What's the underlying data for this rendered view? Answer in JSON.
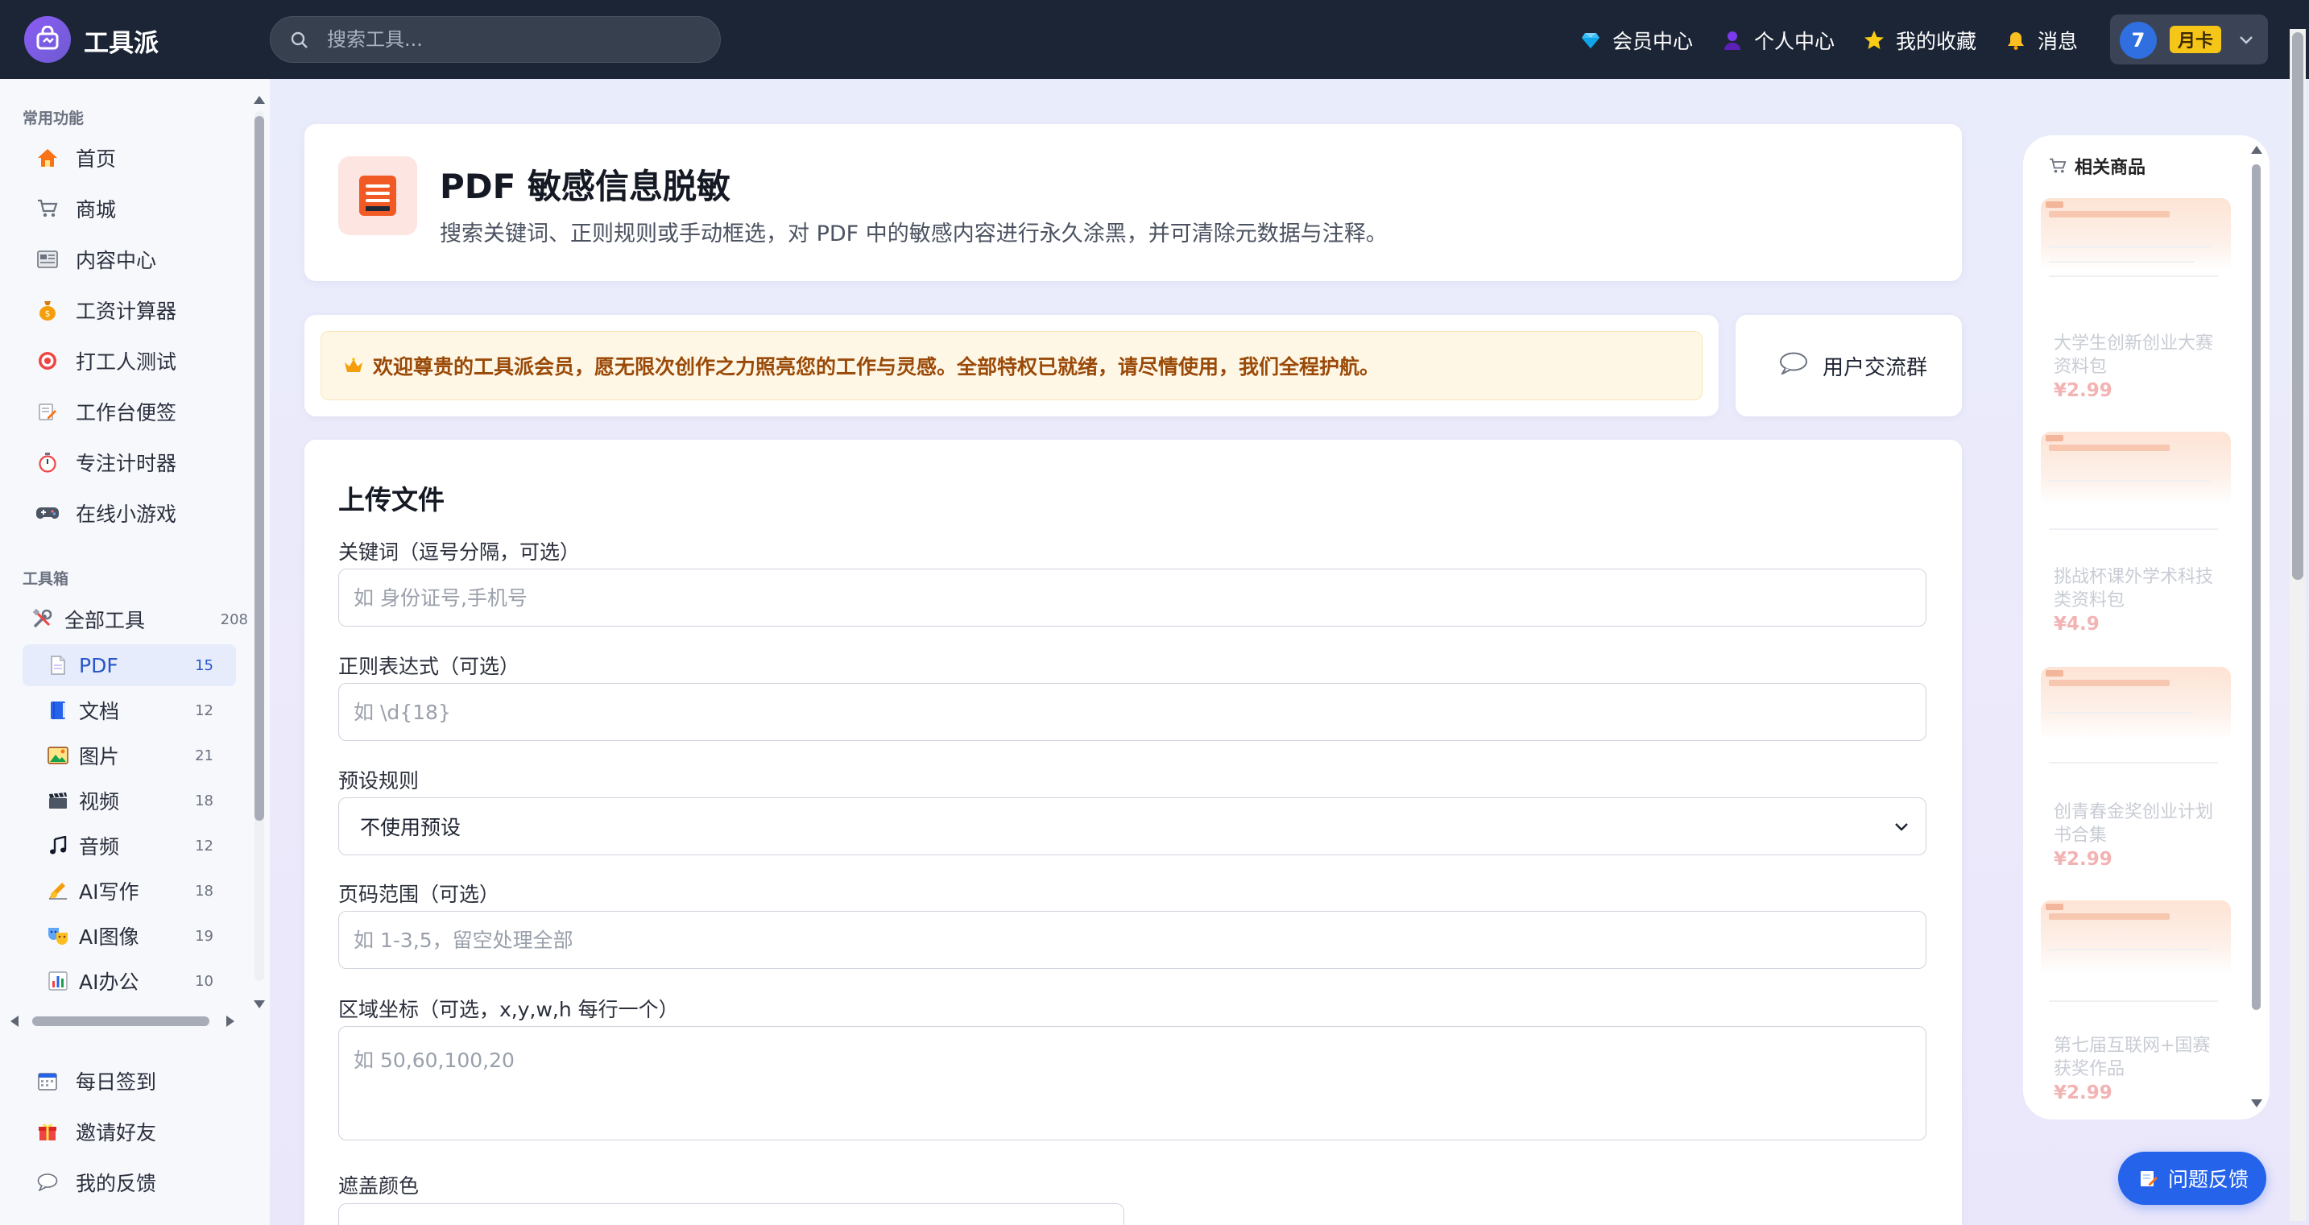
{
  "app": {
    "name": "工具派"
  },
  "search": {
    "placeholder": "搜索工具..."
  },
  "topnav": {
    "items": [
      {
        "label": "会员中心",
        "icon": "diamond-icon"
      },
      {
        "label": "个人中心",
        "icon": "person-icon"
      },
      {
        "label": "我的收藏",
        "icon": "star-icon"
      },
      {
        "label": "消息",
        "icon": "bell-icon"
      }
    ],
    "user": {
      "avatar_text": "7",
      "badge": "月卡"
    }
  },
  "sidebar": {
    "section_common": "常用功能",
    "common_items": [
      {
        "label": "首页",
        "icon": "home-icon"
      },
      {
        "label": "商城",
        "icon": "cart-icon"
      },
      {
        "label": "内容中心",
        "icon": "newspaper-icon"
      },
      {
        "label": "工资计算器",
        "icon": "money-bag-icon"
      },
      {
        "label": "打工人测试",
        "icon": "target-icon"
      },
      {
        "label": "工作台便签",
        "icon": "memo-icon"
      },
      {
        "label": "专注计时器",
        "icon": "stopwatch-icon"
      },
      {
        "label": "在线小游戏",
        "icon": "gamepad-icon"
      }
    ],
    "section_toolbox": "工具箱",
    "all_tools": {
      "label": "全部工具",
      "count": "208",
      "icon": "tools-icon"
    },
    "categories": [
      {
        "label": "PDF",
        "count": "15",
        "icon": "pdf-page-icon",
        "active": true
      },
      {
        "label": "文档",
        "count": "12",
        "icon": "book-icon"
      },
      {
        "label": "图片",
        "count": "21",
        "icon": "picture-icon"
      },
      {
        "label": "视频",
        "count": "18",
        "icon": "clapper-icon"
      },
      {
        "label": "音频",
        "count": "12",
        "icon": "music-note-icon"
      },
      {
        "label": "AI写作",
        "count": "18",
        "icon": "writing-hand-icon"
      },
      {
        "label": "AI图像",
        "count": "19",
        "icon": "theater-mask-icon"
      },
      {
        "label": "AI办公",
        "count": "10",
        "icon": "bar-chart-icon"
      }
    ],
    "bottom_items": [
      {
        "label": "每日签到",
        "icon": "calendar-icon"
      },
      {
        "label": "邀请好友",
        "icon": "gift-icon"
      },
      {
        "label": "我的反馈",
        "icon": "speech-bubble-icon"
      }
    ]
  },
  "tool": {
    "title": "PDF 敏感信息脱敏",
    "description": "搜索关键词、正则规则或手动框选，对 PDF 中的敏感内容进行永久涂黑，并可清除元数据与注释。",
    "icon": "document-icon"
  },
  "welcome": {
    "text": "欢迎尊贵的工具派会员，愿无限次创作之力照亮您的工作与灵感。全部特权已就绪，请尽情使用，我们全程护航。",
    "icon": "crown-icon"
  },
  "group": {
    "label": "用户交流群",
    "icon": "chat-bubble-icon"
  },
  "form": {
    "heading": "上传文件",
    "keywords": {
      "label": "关键词（逗号分隔，可选）",
      "placeholder": "如 身份证号,手机号"
    },
    "regex": {
      "label": "正则表达式（可选）",
      "placeholder": "如 \\d{18}"
    },
    "preset": {
      "label": "预设规则",
      "value": "不使用预设"
    },
    "pages": {
      "label": "页码范围（可选）",
      "placeholder": "如 1-3,5，留空处理全部"
    },
    "regions": {
      "label": "区域坐标（可选，x,y,w,h 每行一个）",
      "placeholder": "如 50,60,100,20"
    },
    "color": {
      "label": "遮盖颜色"
    }
  },
  "related": {
    "title": "相关商品",
    "icon": "cart-icon",
    "items": [
      {
        "name": "大学生创新创业大赛资料包",
        "price": "¥2.99"
      },
      {
        "name": "挑战杯课外学术科技类资料包",
        "price": "¥4.9"
      },
      {
        "name": "创青春金奖创业计划书合集",
        "price": "¥2.99"
      },
      {
        "name": "第七届互联网+国赛获奖作品",
        "price": "¥2.99"
      }
    ]
  },
  "feedback": {
    "label": "问题反馈",
    "icon": "memo-icon"
  },
  "colors": {
    "topbar": "#1c2536",
    "accent": "#2563eb",
    "active_bg": "#e6ecfb",
    "welcome_text": "#9a4a08"
  }
}
